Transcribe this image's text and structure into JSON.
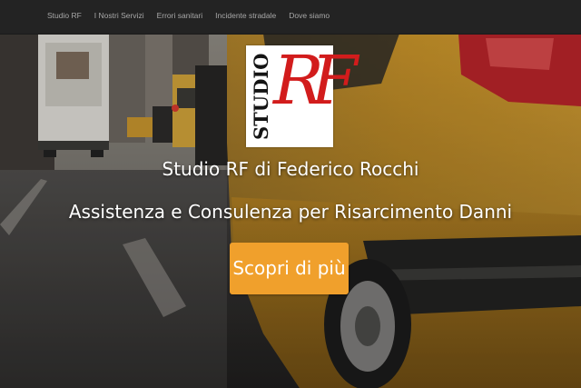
{
  "navbar": {
    "items": [
      {
        "label": "Studio RF"
      },
      {
        "label": "I Nostri Servizi"
      },
      {
        "label": "Errori sanitari"
      },
      {
        "label": "Incidente stradale"
      },
      {
        "label": "Dove siamo"
      }
    ]
  },
  "logo": {
    "studio_text": "STUDIO",
    "monogram": "RF",
    "colors": {
      "monogram": "#d21c1c",
      "studio": "#141414",
      "background": "#ffffff"
    }
  },
  "hero": {
    "title": "Studio RF di Federico Rocchi",
    "subtitle": "Assistenza e Consulenza per Risarcimento Danni",
    "cta_label": "Scopri di più",
    "background_image": "city-street-yellow-taxi-photo",
    "colors": {
      "cta": "#f0a02c",
      "text": "#ffffff"
    }
  },
  "colors": {
    "navbar_bg": "#232323",
    "nav_text": "#a8a8a8"
  }
}
